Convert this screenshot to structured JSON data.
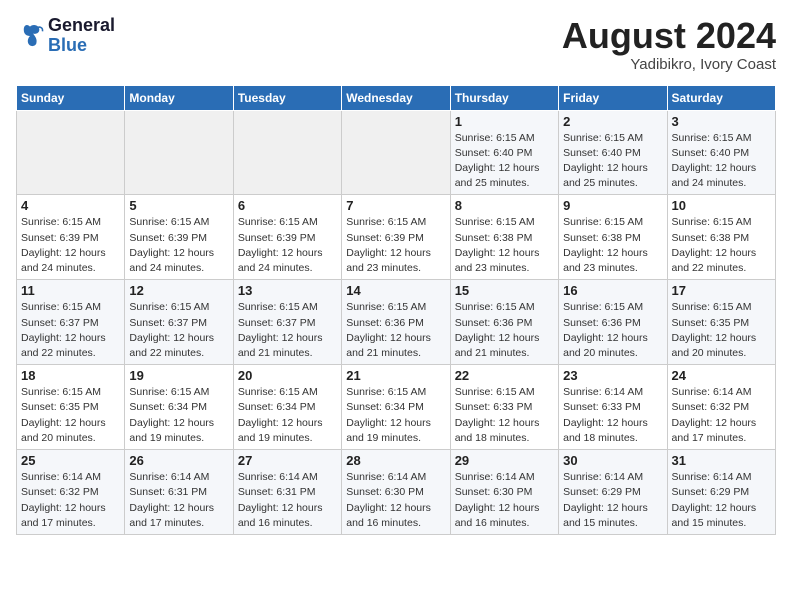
{
  "header": {
    "logo_line1": "General",
    "logo_line2": "Blue",
    "title": "August 2024",
    "subtitle": "Yadibikro, Ivory Coast"
  },
  "weekdays": [
    "Sunday",
    "Monday",
    "Tuesday",
    "Wednesday",
    "Thursday",
    "Friday",
    "Saturday"
  ],
  "weeks": [
    [
      {
        "day": "",
        "info": ""
      },
      {
        "day": "",
        "info": ""
      },
      {
        "day": "",
        "info": ""
      },
      {
        "day": "",
        "info": ""
      },
      {
        "day": "1",
        "info": "Sunrise: 6:15 AM\nSunset: 6:40 PM\nDaylight: 12 hours\nand 25 minutes."
      },
      {
        "day": "2",
        "info": "Sunrise: 6:15 AM\nSunset: 6:40 PM\nDaylight: 12 hours\nand 25 minutes."
      },
      {
        "day": "3",
        "info": "Sunrise: 6:15 AM\nSunset: 6:40 PM\nDaylight: 12 hours\nand 24 minutes."
      }
    ],
    [
      {
        "day": "4",
        "info": "Sunrise: 6:15 AM\nSunset: 6:39 PM\nDaylight: 12 hours\nand 24 minutes."
      },
      {
        "day": "5",
        "info": "Sunrise: 6:15 AM\nSunset: 6:39 PM\nDaylight: 12 hours\nand 24 minutes."
      },
      {
        "day": "6",
        "info": "Sunrise: 6:15 AM\nSunset: 6:39 PM\nDaylight: 12 hours\nand 24 minutes."
      },
      {
        "day": "7",
        "info": "Sunrise: 6:15 AM\nSunset: 6:39 PM\nDaylight: 12 hours\nand 23 minutes."
      },
      {
        "day": "8",
        "info": "Sunrise: 6:15 AM\nSunset: 6:38 PM\nDaylight: 12 hours\nand 23 minutes."
      },
      {
        "day": "9",
        "info": "Sunrise: 6:15 AM\nSunset: 6:38 PM\nDaylight: 12 hours\nand 23 minutes."
      },
      {
        "day": "10",
        "info": "Sunrise: 6:15 AM\nSunset: 6:38 PM\nDaylight: 12 hours\nand 22 minutes."
      }
    ],
    [
      {
        "day": "11",
        "info": "Sunrise: 6:15 AM\nSunset: 6:37 PM\nDaylight: 12 hours\nand 22 minutes."
      },
      {
        "day": "12",
        "info": "Sunrise: 6:15 AM\nSunset: 6:37 PM\nDaylight: 12 hours\nand 22 minutes."
      },
      {
        "day": "13",
        "info": "Sunrise: 6:15 AM\nSunset: 6:37 PM\nDaylight: 12 hours\nand 21 minutes."
      },
      {
        "day": "14",
        "info": "Sunrise: 6:15 AM\nSunset: 6:36 PM\nDaylight: 12 hours\nand 21 minutes."
      },
      {
        "day": "15",
        "info": "Sunrise: 6:15 AM\nSunset: 6:36 PM\nDaylight: 12 hours\nand 21 minutes."
      },
      {
        "day": "16",
        "info": "Sunrise: 6:15 AM\nSunset: 6:36 PM\nDaylight: 12 hours\nand 20 minutes."
      },
      {
        "day": "17",
        "info": "Sunrise: 6:15 AM\nSunset: 6:35 PM\nDaylight: 12 hours\nand 20 minutes."
      }
    ],
    [
      {
        "day": "18",
        "info": "Sunrise: 6:15 AM\nSunset: 6:35 PM\nDaylight: 12 hours\nand 20 minutes."
      },
      {
        "day": "19",
        "info": "Sunrise: 6:15 AM\nSunset: 6:34 PM\nDaylight: 12 hours\nand 19 minutes."
      },
      {
        "day": "20",
        "info": "Sunrise: 6:15 AM\nSunset: 6:34 PM\nDaylight: 12 hours\nand 19 minutes."
      },
      {
        "day": "21",
        "info": "Sunrise: 6:15 AM\nSunset: 6:34 PM\nDaylight: 12 hours\nand 19 minutes."
      },
      {
        "day": "22",
        "info": "Sunrise: 6:15 AM\nSunset: 6:33 PM\nDaylight: 12 hours\nand 18 minutes."
      },
      {
        "day": "23",
        "info": "Sunrise: 6:14 AM\nSunset: 6:33 PM\nDaylight: 12 hours\nand 18 minutes."
      },
      {
        "day": "24",
        "info": "Sunrise: 6:14 AM\nSunset: 6:32 PM\nDaylight: 12 hours\nand 17 minutes."
      }
    ],
    [
      {
        "day": "25",
        "info": "Sunrise: 6:14 AM\nSunset: 6:32 PM\nDaylight: 12 hours\nand 17 minutes."
      },
      {
        "day": "26",
        "info": "Sunrise: 6:14 AM\nSunset: 6:31 PM\nDaylight: 12 hours\nand 17 minutes."
      },
      {
        "day": "27",
        "info": "Sunrise: 6:14 AM\nSunset: 6:31 PM\nDaylight: 12 hours\nand 16 minutes."
      },
      {
        "day": "28",
        "info": "Sunrise: 6:14 AM\nSunset: 6:30 PM\nDaylight: 12 hours\nand 16 minutes."
      },
      {
        "day": "29",
        "info": "Sunrise: 6:14 AM\nSunset: 6:30 PM\nDaylight: 12 hours\nand 16 minutes."
      },
      {
        "day": "30",
        "info": "Sunrise: 6:14 AM\nSunset: 6:29 PM\nDaylight: 12 hours\nand 15 minutes."
      },
      {
        "day": "31",
        "info": "Sunrise: 6:14 AM\nSunset: 6:29 PM\nDaylight: 12 hours\nand 15 minutes."
      }
    ]
  ]
}
